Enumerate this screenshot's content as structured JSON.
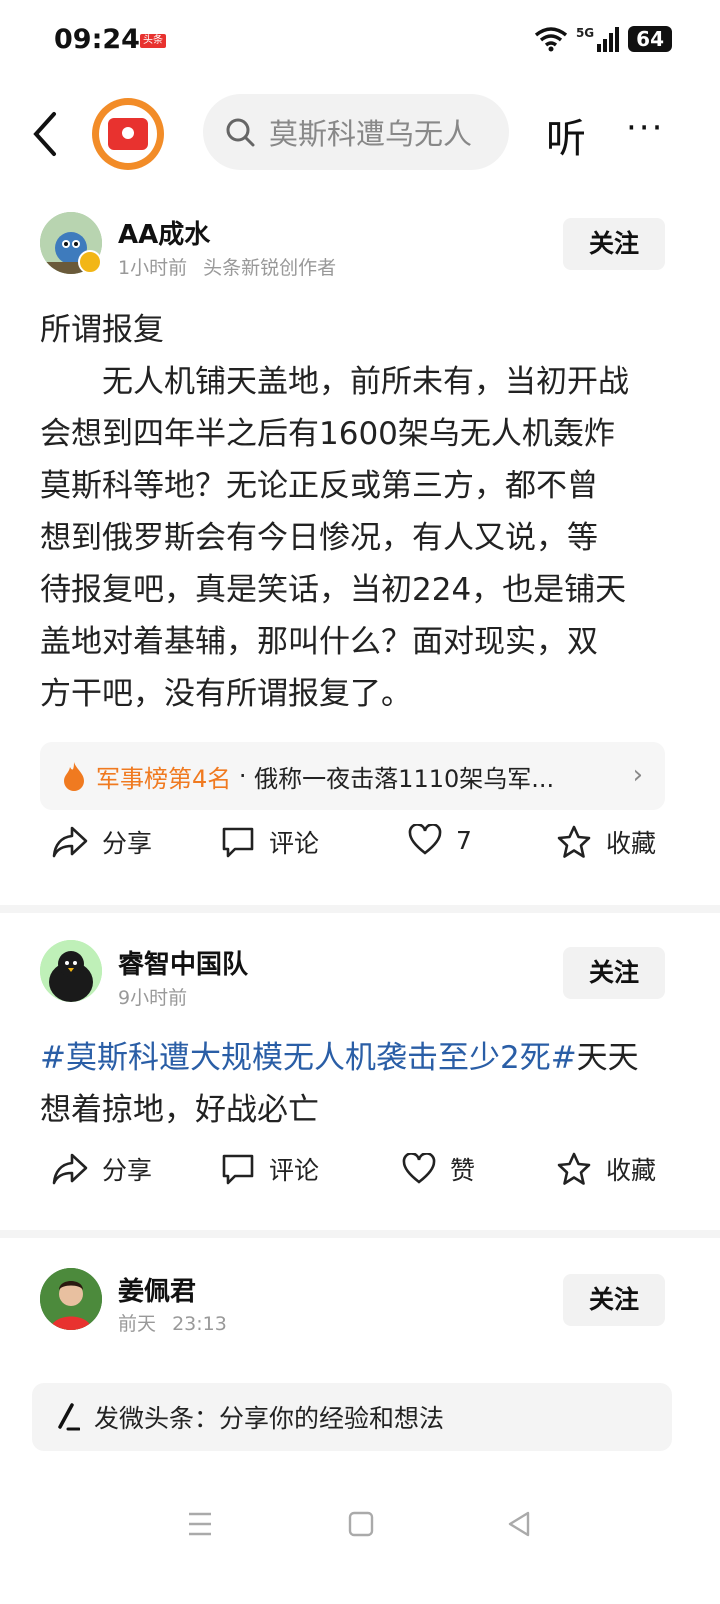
{
  "status": {
    "time": "09:24",
    "app_tag": "头条",
    "network": "5G",
    "battery": "64"
  },
  "topbar": {
    "search_placeholder": "莫斯科遭乌无人",
    "listen_label": "听",
    "more_label": "···"
  },
  "posts": [
    {
      "author": "AA成水",
      "time": "1小时前",
      "badge": "头条新锐创作者",
      "follow_label": "关注",
      "lines": [
        "所谓报复",
        "　　无人机铺天盖地，前所未有，当初开战",
        "会想到四年半之后有1600架乌无人机轰炸",
        "莫斯科等地？无论正反或第三方，都不曾",
        "想到俄罗斯会有今日惨况，有人又说，等",
        "待报复吧，真是笑话，当初224，也是铺天",
        "盖地对着基辅，那叫什么？面对现实，双",
        "方干吧，没有所谓报复了。"
      ],
      "hot": {
        "rank": "军事榜第4名",
        "separator": " · ",
        "title": "俄称一夜击落1110架乌军..."
      },
      "actions": {
        "share": "分享",
        "comment": "评论",
        "like": "7",
        "fav": "收藏"
      }
    },
    {
      "author": "睿智中国队",
      "time": "9小时前",
      "follow_label": "关注",
      "hashtag": "#莫斯科遭大规模无人机袭击至少2死#",
      "text_after_tag": "天天",
      "line2": "想着掠地，好战必亡",
      "actions": {
        "share": "分享",
        "comment": "评论",
        "like": "赞",
        "fav": "收藏"
      }
    },
    {
      "author": "姜佩君",
      "time": "前天",
      "time2": "23:13",
      "follow_label": "关注"
    }
  ],
  "composer": {
    "placeholder": "发微头条：分享你的经验和想法"
  },
  "colors": {
    "accent": "#f07a20",
    "hashtag": "#2a5ea6",
    "brand_red": "#e8322f"
  }
}
